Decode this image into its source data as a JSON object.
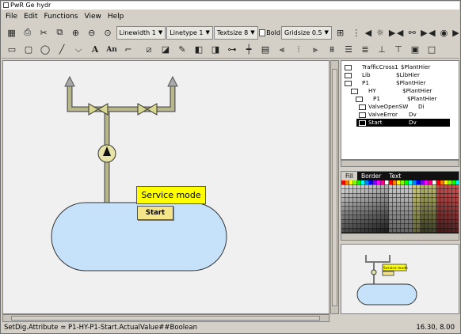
{
  "window": {
    "title": "PwR Ge  hydr"
  },
  "menu": [
    "File",
    "Edit",
    "Functions",
    "View",
    "Help"
  ],
  "toolbar1": {
    "linewidth": "Linewidth 1",
    "linetype": "Linetype 1",
    "textsize": "Textsize 8",
    "bold_label": "Bold",
    "gridsize": "Gridsize 0.5"
  },
  "canvas": {
    "service_label": "Service mode",
    "start_label": "Start"
  },
  "tree": [
    {
      "name": "TrafficCross1",
      "class": "$PlantHier",
      "indent": 0
    },
    {
      "name": "Lib",
      "class": "$LibHier",
      "indent": 0
    },
    {
      "name": "P1",
      "class": "$PlantHier",
      "indent": 0
    },
    {
      "name": "HY",
      "class": "$PlantHier",
      "indent": 1
    },
    {
      "name": "P1",
      "class": "$PlantHier",
      "indent": 2
    },
    {
      "name": "ValveOpenSW",
      "class": "Di",
      "indent": 3
    },
    {
      "name": "ValveError",
      "class": "Dv",
      "indent": 3
    },
    {
      "name": "Start",
      "class": "Dv",
      "indent": 3,
      "selected": true
    }
  ],
  "palette": {
    "tabs": [
      "Fill",
      "Border",
      "Text"
    ]
  },
  "nav": {
    "service_label": "Service mode"
  },
  "status": {
    "text": "SetDig.Attribute = P1-HY-P1-Start.ActualValue##Boolean",
    "coords": "16.30,  8.00"
  },
  "colors": {
    "tank": "#c6e2fa",
    "pipe": "#b7b78a",
    "service_bg": "#ffff00",
    "start_bg": "#f5e58a"
  }
}
